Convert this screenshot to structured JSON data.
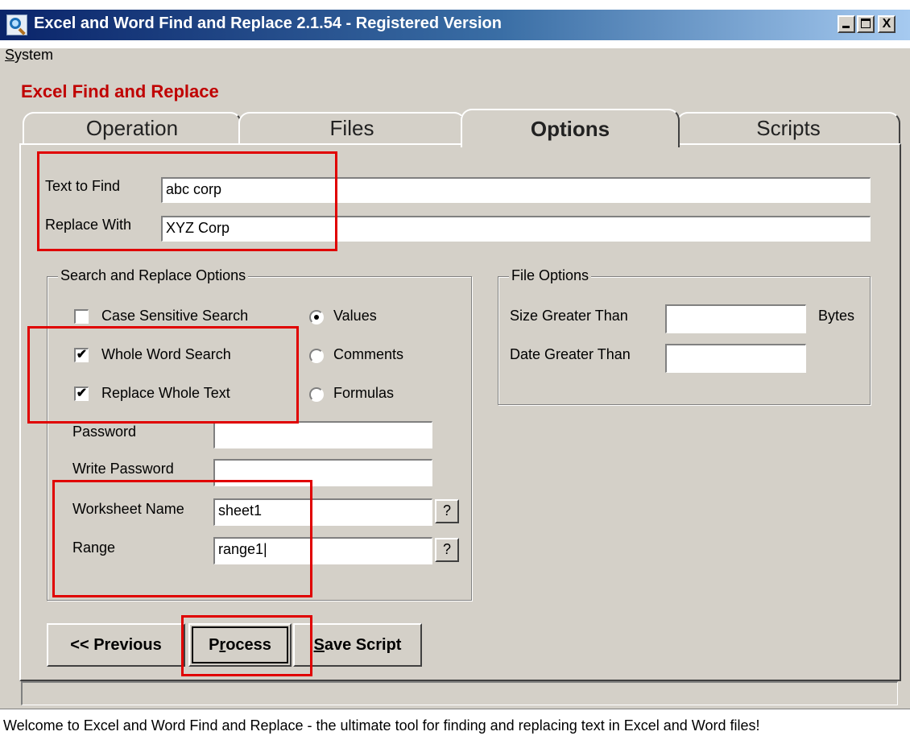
{
  "window": {
    "title": "Excel and Word Find and Replace 2.1.54 - Registered Version",
    "controls": [
      "_",
      "□",
      "X"
    ]
  },
  "menu": {
    "system": "ystem",
    "system_accel": "S"
  },
  "section_title": "Excel Find and Replace",
  "tabs": [
    {
      "label": "Operation",
      "active": false
    },
    {
      "label": "Files",
      "active": false
    },
    {
      "label": "Options",
      "active": true
    },
    {
      "label": "Scripts",
      "active": false
    }
  ],
  "find": {
    "label": "Text to Find",
    "value": "abc corp"
  },
  "replace": {
    "label": "Replace With",
    "value": "XYZ Corp"
  },
  "search_options": {
    "title": "Search and Replace Options",
    "checkboxes": [
      {
        "label": "Case Sensitive Search",
        "checked": false
      },
      {
        "label": "Whole Word Search",
        "checked": true
      },
      {
        "label": "Replace Whole Text",
        "checked": true
      }
    ],
    "radios": [
      {
        "label": "Values",
        "selected": true
      },
      {
        "label": "Comments",
        "selected": false
      },
      {
        "label": "Formulas",
        "selected": false
      }
    ],
    "password": {
      "label": "Password",
      "value": ""
    },
    "write_password": {
      "label": "Write Password",
      "value": ""
    },
    "worksheet": {
      "label": "Worksheet Name",
      "value": "sheet1",
      "help": "?"
    },
    "range": {
      "label": "Range",
      "value": "range1|",
      "help": "?"
    }
  },
  "file_options": {
    "title": "File Options",
    "size": {
      "label": "Size Greater Than",
      "value": "",
      "unit": "Bytes"
    },
    "date": {
      "label": "Date Greater Than",
      "value": ""
    }
  },
  "buttons": {
    "previous": "<< Previous",
    "process_accel": "r",
    "process_pre": "P",
    "process_post": "ocess",
    "save_accel": "S",
    "save_post": "ave Script"
  },
  "status": "Welcome to Excel and Word Find and Replace - the ultimate tool for finding and replacing text in Excel and Word files!"
}
